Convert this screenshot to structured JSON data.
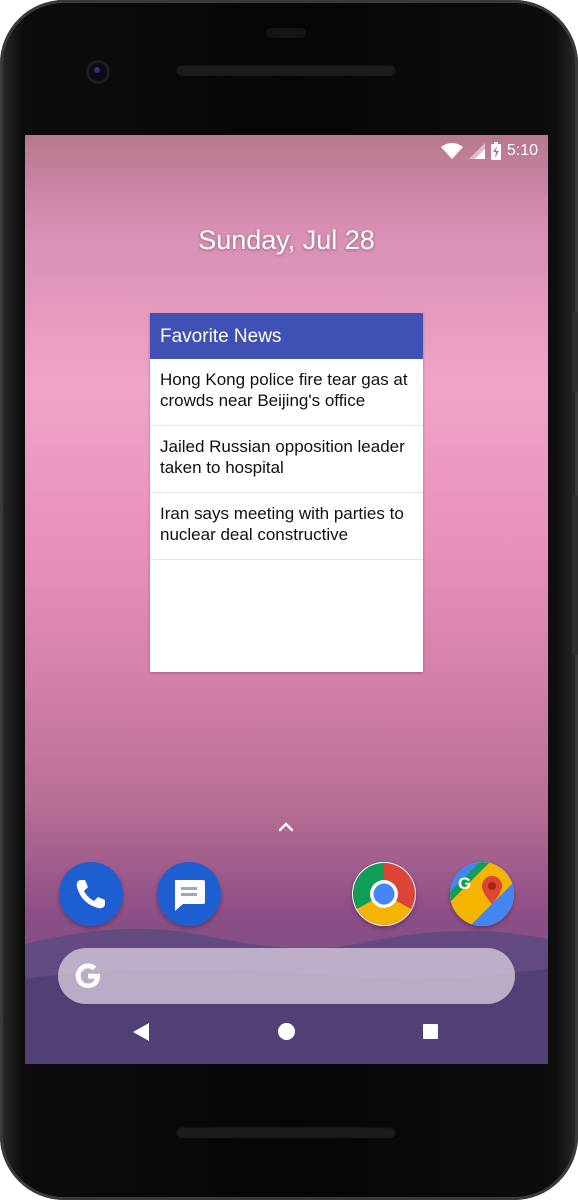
{
  "status_bar": {
    "time": "5:10",
    "icons": [
      "wifi-icon",
      "cell-signal-icon",
      "battery-charging-icon"
    ]
  },
  "date": "Sunday, Jul 28",
  "widget": {
    "title": "Favorite News",
    "items": [
      {
        "headline": "Hong Kong police fire tear gas at crowds near Beijing's office"
      },
      {
        "headline": "Jailed Russian opposition leader taken to hospital"
      },
      {
        "headline": "Iran says meeting with parties to nuclear deal constructive"
      }
    ]
  },
  "dock": {
    "apps": [
      "phone-icon",
      "messages-icon",
      "chrome-icon",
      "maps-icon"
    ]
  },
  "search": {
    "logo": "google-g-icon"
  },
  "nav": {
    "buttons": [
      "back-icon",
      "home-icon",
      "recents-icon"
    ]
  },
  "colors": {
    "widget_header": "#3f51b5",
    "wallpaper_top": "#f0a4c8",
    "wallpaper_bottom": "#6b4c84"
  }
}
